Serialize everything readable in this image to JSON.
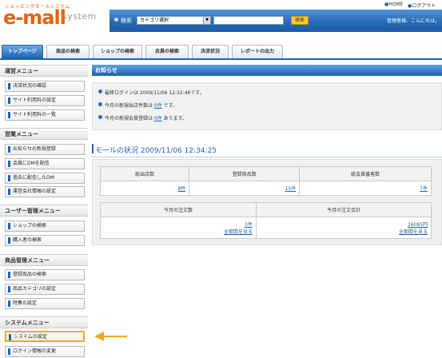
{
  "header": {
    "logo_subtitle": "ショッピングモールシステム",
    "logo_text": "e-mall",
    "logo_tagline": "system",
    "search_label": "検索",
    "category_select_value": "カテゴリ選択",
    "search_button": "検索",
    "home_link": "HOME",
    "logout_link": "ログアウト",
    "greeting": "管理者様、こんにちは。"
  },
  "tabs": [
    {
      "label": "トップページ",
      "active": true
    },
    {
      "label": "商品の検索"
    },
    {
      "label": "ショップの検索"
    },
    {
      "label": "会員の検索"
    },
    {
      "label": "決済状況"
    },
    {
      "label": "レポートの出力"
    }
  ],
  "sidebar": {
    "sections": [
      {
        "title": "運営メニュー",
        "items": [
          "決済状況の確認",
          "サイト利用料の設定",
          "サイト利用料の一覧"
        ]
      },
      {
        "title": "営業メニュー",
        "items": [
          "お知らせの新規登録",
          "会員にDMを配信",
          "過去に配信したDM",
          "運営会社情報の設定"
        ]
      },
      {
        "title": "ユーザー管理メニュー",
        "items": [
          "ショップの検索",
          "購入者の検索"
        ]
      },
      {
        "title": "商品管理メニュー",
        "items": [
          "登録商品の検索",
          "商品カテゴリの設定",
          "特集の設定"
        ]
      },
      {
        "title": "システムメニュー",
        "items": [
          "システムの設定",
          "ログイン情報の変更"
        ]
      }
    ]
  },
  "notice": {
    "title": "お知らせ",
    "lines": [
      {
        "prefix": "最終ログインは 2009/11/06 12:32:46です。",
        "link": "",
        "suffix": ""
      },
      {
        "prefix": "今月の新規出店件数は ",
        "link": "0件",
        "suffix": " です。"
      },
      {
        "prefix": "今月の新規会員登録は ",
        "link": "0件",
        "suffix": " あります。"
      }
    ]
  },
  "status": {
    "title": "モールの状況 2009/11/06 12:34:25",
    "table1": {
      "headers": [
        "総出店数",
        "登録商品数",
        "総会員番客数"
      ],
      "values": [
        "8件",
        "15件",
        "7件"
      ]
    },
    "table2": {
      "headers": [
        "今月の注文数",
        "今月の注文合計"
      ],
      "values": [
        "3件",
        "26085円"
      ],
      "links": [
        "全期間を見る",
        "全期間を見る"
      ]
    }
  },
  "colors": {
    "brand": "#e8600a",
    "primary": "#1d64b5",
    "highlight": "#f5a623"
  }
}
